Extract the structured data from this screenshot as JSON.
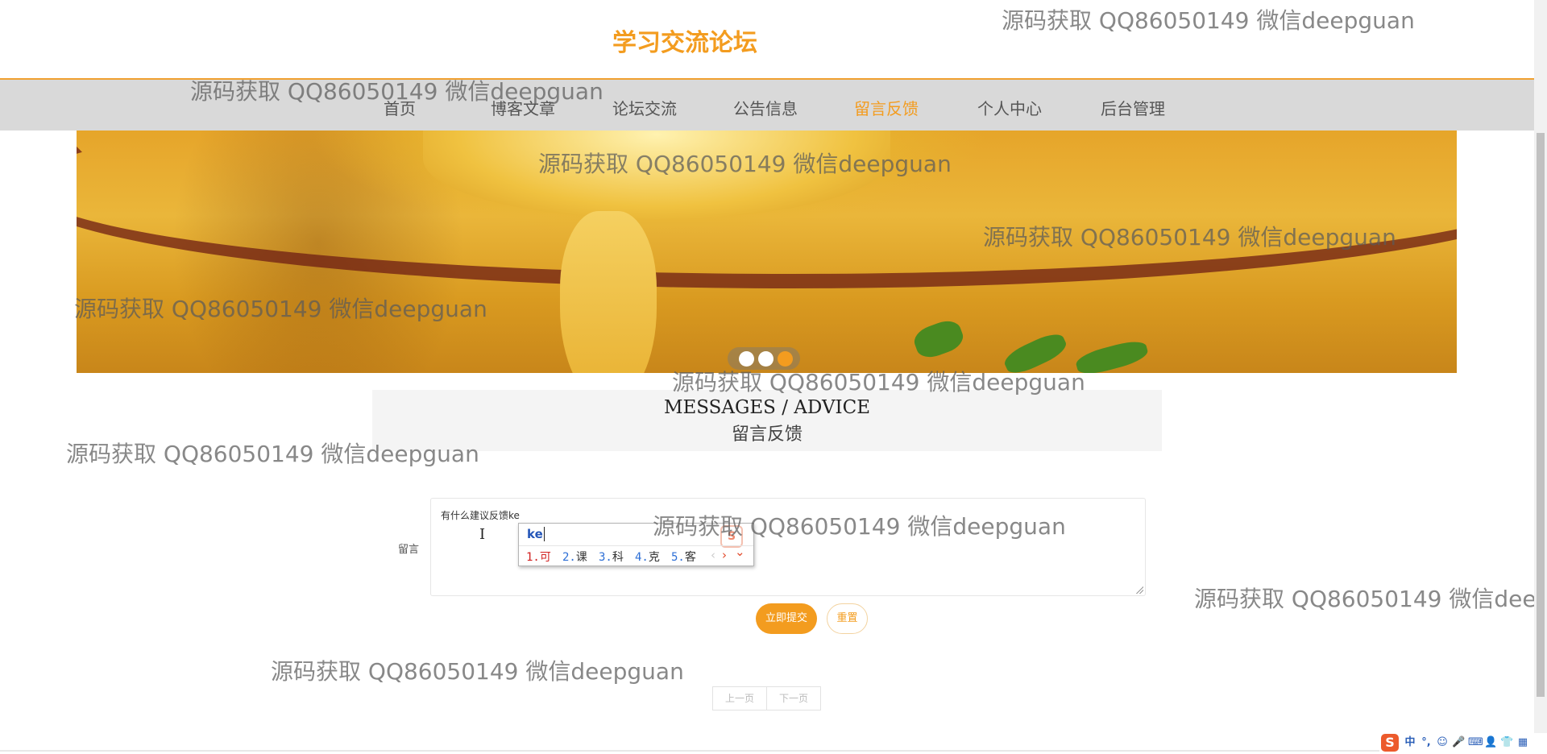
{
  "header": {
    "site_title": "学习交流论坛"
  },
  "nav": {
    "items": [
      {
        "label": "首页"
      },
      {
        "label": "博客文章"
      },
      {
        "label": "论坛交流"
      },
      {
        "label": "公告信息"
      },
      {
        "label": "留言反馈",
        "active": true
      },
      {
        "label": "个人中心"
      },
      {
        "label": "后台管理"
      }
    ]
  },
  "banner": {
    "slide_count": 3,
    "active_slide": 3
  },
  "section": {
    "title_en": "MESSAGES / ADVICE",
    "title_cn": "留言反馈"
  },
  "form": {
    "label": "留言",
    "textarea_value": "有什么建议反馈ke",
    "submit_label": "立即提交",
    "reset_label": "重置"
  },
  "ime": {
    "composition": "ke",
    "candidates": [
      {
        "num": "1.",
        "text": "可"
      },
      {
        "num": "2.",
        "text": "课"
      },
      {
        "num": "3.",
        "text": "科"
      },
      {
        "num": "4.",
        "text": "克"
      },
      {
        "num": "5.",
        "text": "客"
      }
    ],
    "prev_icon": "chevron-left-icon",
    "next_icon": "chevron-right-icon",
    "expand_icon": "chevron-down-icon",
    "prev_arrow": "‹",
    "next_arrow": "›",
    "expand_arrow": "⌄",
    "logo_glyph": "S"
  },
  "pagination": {
    "prev_label": "上一页",
    "next_label": "下一页"
  },
  "watermark_text": "源码获取 QQ86050149 微信deepguan",
  "tray": {
    "logo_glyph": "S",
    "items": [
      {
        "glyph": "中",
        "icon": "chinese-mode-icon"
      },
      {
        "glyph": "°,",
        "icon": "punctuation-icon"
      },
      {
        "glyph": "☺",
        "icon": "emoji-icon"
      },
      {
        "glyph": "🎤",
        "icon": "microphone-icon"
      },
      {
        "glyph": "⌨",
        "icon": "keyboard-icon"
      },
      {
        "glyph": "👤",
        "icon": "user-icon"
      },
      {
        "glyph": "👕",
        "icon": "skin-icon"
      },
      {
        "glyph": "▦",
        "icon": "toolbox-icon"
      }
    ]
  },
  "colors": {
    "accent": "#f39c1f",
    "nav_bg": "#d9d9d9"
  }
}
